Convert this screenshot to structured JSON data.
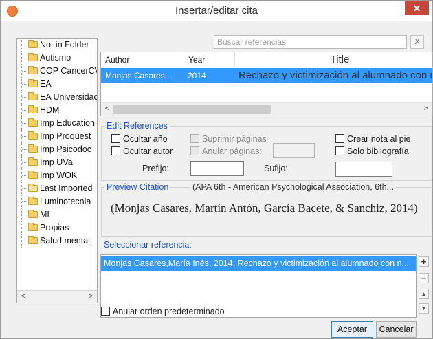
{
  "window": {
    "title": "Insertar/editar cita",
    "close_glyph": "✕",
    "app_icon": "orange-circle-app-icon"
  },
  "folders": {
    "items": [
      {
        "label": "Not in Folder",
        "open": false
      },
      {
        "label": "Autismo",
        "open": false
      },
      {
        "label": "COP CancerCV",
        "open": false
      },
      {
        "label": "EA",
        "open": false
      },
      {
        "label": "EA Universidad",
        "open": false
      },
      {
        "label": "HDM",
        "open": false
      },
      {
        "label": "Imp Education",
        "open": false
      },
      {
        "label": "Imp Proquest",
        "open": false
      },
      {
        "label": "Imp Psicodoc",
        "open": false
      },
      {
        "label": "Imp UVa",
        "open": false
      },
      {
        "label": "Imp WOK",
        "open": false
      },
      {
        "label": "Last Imported",
        "open": true
      },
      {
        "label": "Luminotecnia",
        "open": false
      },
      {
        "label": "MI",
        "open": false
      },
      {
        "label": "Propias",
        "open": false
      },
      {
        "label": "Salud mental",
        "open": false
      }
    ],
    "scroll_left": "<",
    "scroll_right": ">"
  },
  "search": {
    "placeholder": "Buscar referencias",
    "clear_label": "X"
  },
  "results": {
    "columns": {
      "author": "Author",
      "year": "Year",
      "title": "Title"
    },
    "rows": [
      {
        "author": "Monjas Casares,...",
        "year": "2014",
        "title": "Rechazo y victimización al alumnado con necesi"
      }
    ],
    "scroll_left": "<",
    "scroll_right": ">"
  },
  "edit_references": {
    "legend": "Edit References",
    "ocultar_anio": "Ocultar año",
    "ocultar_autor": "Ocultar autor",
    "suprimir_paginas": "Suprimir páginas",
    "anular_paginas": "Anular páginas:",
    "crear_nota": "Crear nota al pie",
    "solo_bibliografia": "Solo bibliografía",
    "prefijo": "Prefijo:",
    "sufijo": "Sufijo:"
  },
  "preview": {
    "legend": "Preview Citation",
    "style": "(APA 6th - American Psychological Association, 6th...",
    "citation": "(Monjas Casares, Martín Antón, García Bacete, & Sanchiz, 2014)"
  },
  "selected": {
    "label": "Seleccionar referencia:",
    "items": [
      "Monjas Casares,María Inés, 2014, Rechazo y victimización al alumnado con n..."
    ],
    "add_label": "+",
    "remove_label": "−",
    "up_label": "▲",
    "down_label": "▼"
  },
  "footer": {
    "override_order": "Anular orden predeterminado",
    "accept": "Aceptar",
    "cancel": "Cancelar"
  }
}
